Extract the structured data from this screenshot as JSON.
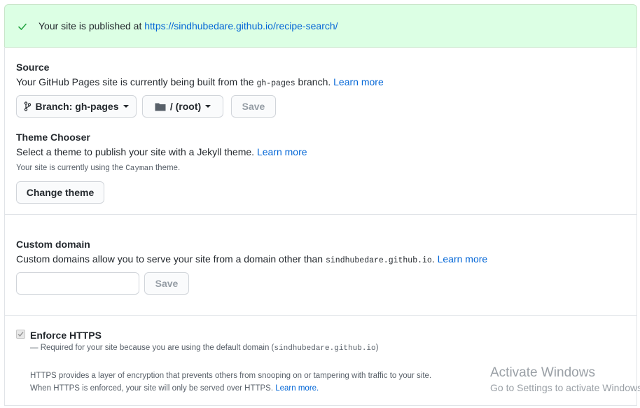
{
  "banner": {
    "message_prefix": "Your site is published at ",
    "url": "https://sindhubedare.github.io/recipe-search/"
  },
  "source": {
    "title": "Source",
    "desc_prefix": "Your GitHub Pages site is currently being built from the ",
    "branch_code": "gh-pages",
    "desc_suffix": " branch. ",
    "learn_more": "Learn more",
    "branch_button": "Branch: gh-pages",
    "folder_button": "/ (root)",
    "save_button": "Save"
  },
  "theme": {
    "title": "Theme Chooser",
    "desc": "Select a theme to publish your site with a Jekyll theme. ",
    "learn_more": "Learn more",
    "current_prefix": "Your site is currently using the ",
    "current_theme": "Cayman",
    "current_suffix": " theme.",
    "change_button": "Change theme"
  },
  "custom_domain": {
    "title": "Custom domain",
    "desc_prefix": "Custom domains allow you to serve your site from a domain other than ",
    "domain_code": "sindhubedare.github.io",
    "desc_suffix": ". ",
    "learn_more": "Learn more",
    "input_value": "",
    "save_button": "Save"
  },
  "https": {
    "title": "Enforce HTTPS",
    "checked": true,
    "required_prefix": "— Required for your site because you are using the default domain (",
    "required_domain": "sindhubedare.github.io",
    "required_suffix": ")",
    "info_line1": "HTTPS provides a layer of encryption that prevents others from snooping on or tampering with traffic to your site.",
    "info_line2": "When HTTPS is enforced, your site will only be served over HTTPS. ",
    "learn_more": "Learn more."
  },
  "watermark": {
    "title": "Activate Windows",
    "subtitle": "Go to Settings to activate Windows."
  },
  "colors": {
    "banner_bg": "#dcffe4",
    "check": "#28a745",
    "link": "#0366d6"
  }
}
